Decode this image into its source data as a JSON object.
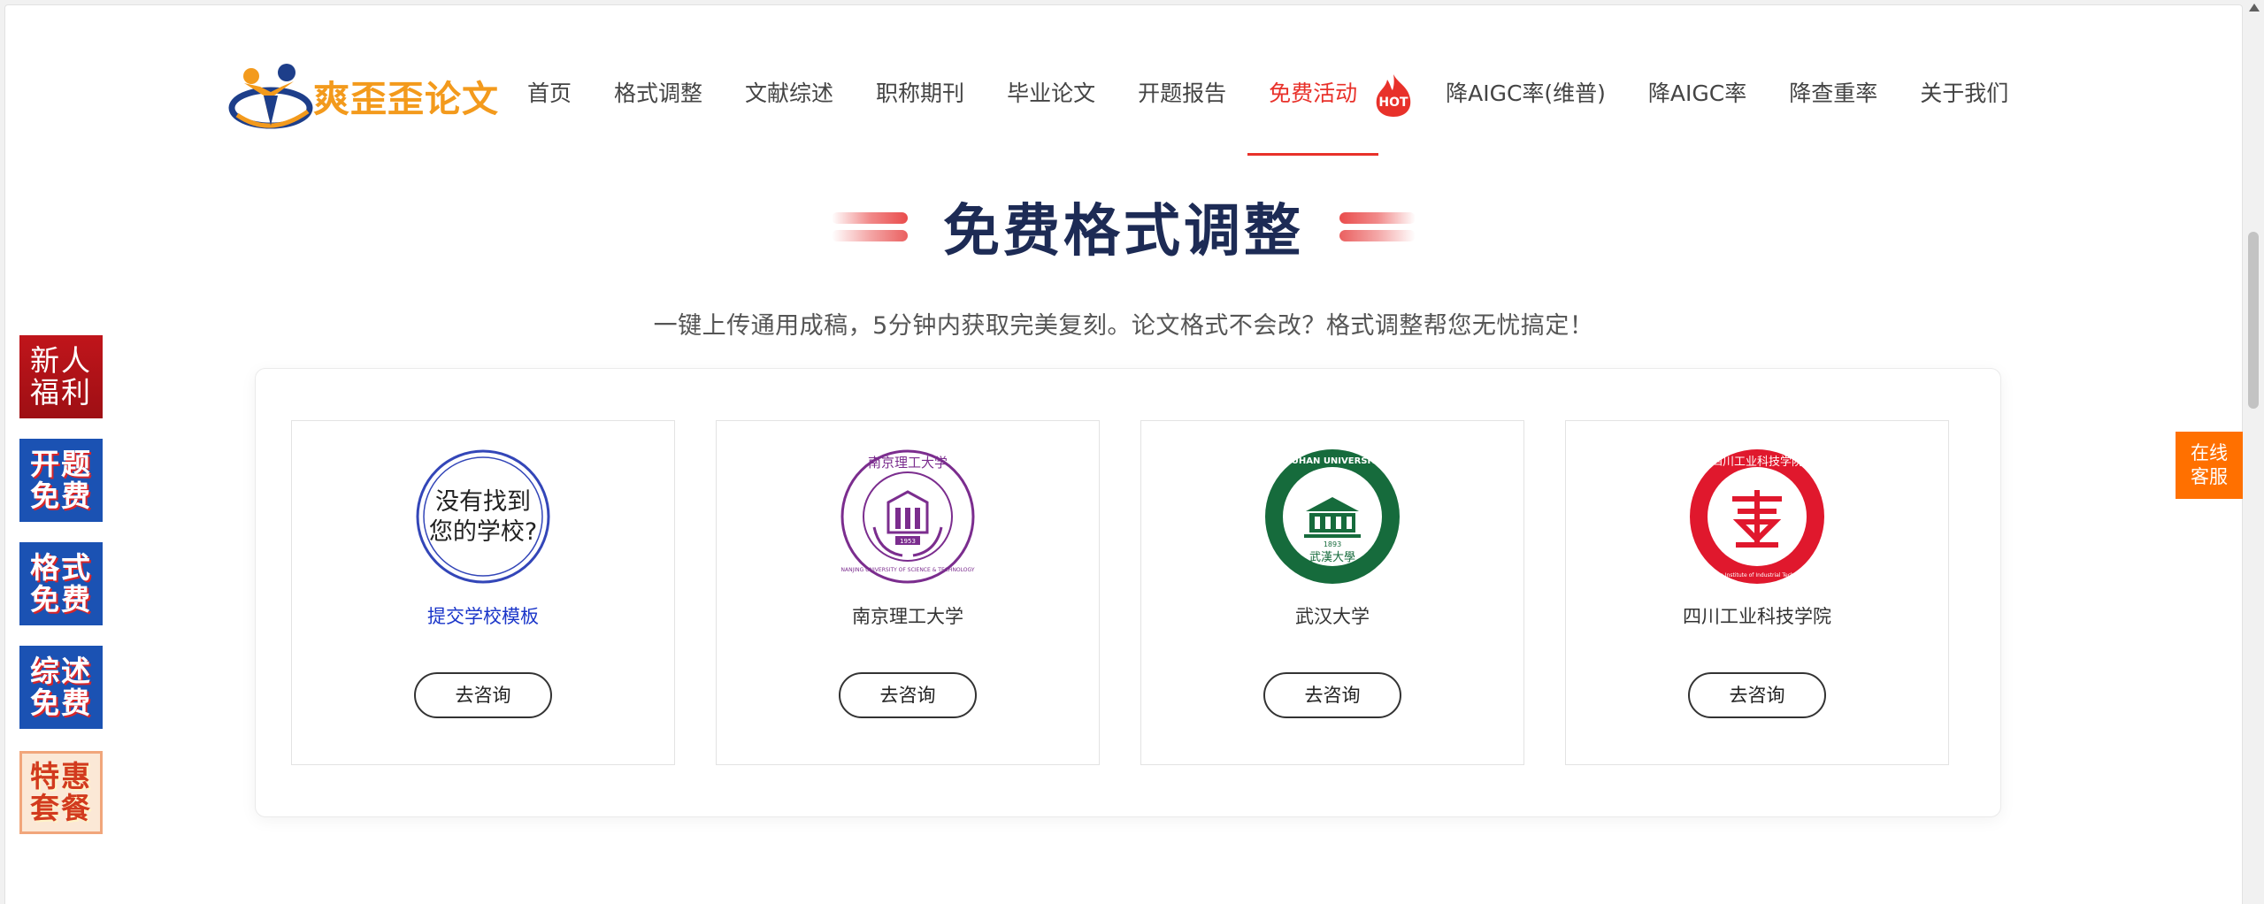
{
  "brand": {
    "name": "爽歪歪论文"
  },
  "nav": {
    "items": [
      {
        "label": "首页"
      },
      {
        "label": "格式调整"
      },
      {
        "label": "文献综述"
      },
      {
        "label": "职称期刊"
      },
      {
        "label": "毕业论文"
      },
      {
        "label": "开题报告"
      },
      {
        "label": "免费活动",
        "badge": "HOT",
        "active": true
      },
      {
        "label": "降AIGC率(维普)"
      },
      {
        "label": "降AIGC率"
      },
      {
        "label": "降查重率"
      },
      {
        "label": "关于我们"
      }
    ]
  },
  "section": {
    "title": "免费格式调整",
    "subtitle": "一键上传通用成稿，5分钟内获取完美复刻。论文格式不会改？格式调整帮您无忧搞定！"
  },
  "schools": [
    {
      "seal_text": "没有找到您的学校?",
      "seal_line1": "没有找到",
      "seal_line2": "您的学校?",
      "name": "提交学校模板",
      "button": "去咨询",
      "seal_color": "#3346b8"
    },
    {
      "name": "南京理工大学",
      "button": "去咨询",
      "seal_color": "#7b2d8e",
      "seal_top": "南京理工大学",
      "seal_bottom": "NANJING UNIVERSITY OF SCIENCE & TECHNOLOGY",
      "seal_year": "1953"
    },
    {
      "name": "武汉大学",
      "button": "去咨询",
      "seal_color": "#166b3c",
      "seal_top": "WUHAN UNIVERSITY",
      "seal_year": "1893",
      "seal_bottom": "武漢大學"
    },
    {
      "name": "四川工业科技学院",
      "button": "去咨询",
      "seal_color": "#e0182d",
      "seal_top": "四川工业科技学院",
      "seal_bottom": "Sichuan Institute of Industrial Technology"
    }
  ],
  "side_badges": [
    {
      "line1": "新人",
      "line2": "福利"
    },
    {
      "line1": "开题",
      "line2": "免费"
    },
    {
      "line1": "格式",
      "line2": "免费"
    },
    {
      "line1": "综述",
      "line2": "免费"
    },
    {
      "line1": "特惠",
      "line2": "套餐"
    }
  ],
  "service": {
    "line1": "在线",
    "line2": "客服"
  },
  "colors": {
    "accent": "#e8312a",
    "title": "#1d2b55",
    "brand": "#f39a1c",
    "service": "#ff7000",
    "side_blue": "#1b52b3"
  }
}
